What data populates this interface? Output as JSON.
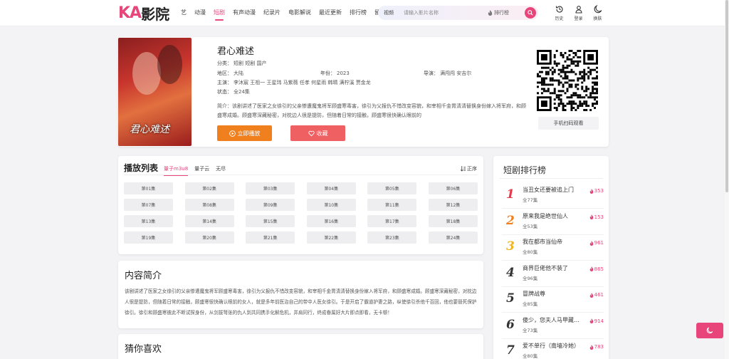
{
  "logo": {
    "ka": "KA",
    "name": "影院"
  },
  "nav": [
    "艺",
    "动漫",
    "短剧",
    "有声动漫",
    "纪录片",
    "电影解说",
    "最近更新",
    "排行榜",
    "留"
  ],
  "nav_active": 2,
  "search": {
    "category": "视频",
    "placeholder": "请输入影片名称",
    "rank_label": "排行榜"
  },
  "header_icons": [
    {
      "label": "历史",
      "icon": "history-icon"
    },
    {
      "label": "登录",
      "icon": "user-icon"
    },
    {
      "label": "换肤",
      "icon": "moon-icon"
    }
  ],
  "detail": {
    "poster_text": "君心难述",
    "title": "君心难述",
    "category_label": "分类：",
    "category": "短剧  短剧  国产",
    "region_label": "地区：",
    "region": "大陆",
    "year_label": "年份：",
    "year": "2023",
    "director_label": "导演：",
    "director": "满闯闯  安吉尔",
    "cast_label": "主演：",
    "cast": "李沐宸  王祖一  王星玮  马紫薇  任孝  何星雨  韩晴  满柠溪  贾金龙",
    "status_label": "状态：",
    "status": "全24集",
    "desc": "简介：该剧讲述了医家之女徐引的父亲惨遭魔鬼将军顾盛寒毒害，徐引为父报仇不惜改变容貌，和宰相千金胃清清替换身份嫁入将军府，和顾盛寒成婚。顾盛寒深藏秘密，对枕边人很是提防，但随着日常的接触，顾盛寒很快确认眼前的",
    "play_label": "立即播放",
    "fav_label": "收藏",
    "qr_label": "手机扫码观看"
  },
  "playlist": {
    "title": "播放列表",
    "tabs": [
      "量子m3u8",
      "量子云",
      "无尽"
    ],
    "active_tab": 0,
    "sort_label": "正序",
    "episodes": [
      "第01集",
      "第02集",
      "第03集",
      "第04集",
      "第05集",
      "第06集",
      "第07集",
      "第08集",
      "第09集",
      "第10集",
      "第11集",
      "第12集",
      "第13集",
      "第14集",
      "第15集",
      "第16集",
      "第17集",
      "第18集",
      "第19集",
      "第20集",
      "第21集",
      "第22集",
      "第23集",
      "第24集"
    ]
  },
  "intro": {
    "title": "内容简介",
    "text": "该剧讲述了医家之女徐引的父亲惨遭魔鬼将军顾盛寒毒害，徐引为父报仇不惜改变容貌，和宰相千金胃清清替换身份嫁入将军府，和顾盛寒成婚。顾盛寒深藏秘密，对枕边人很是提防，但随着日常的接触，顾盛寒很快确认眼前的女人，就是多年前医治自己的带中人医女徐引。于是开启了霸道护妻之路，纵使徐引杀他千百回，他也要替死保护徐引。徐引和顾盛寒彼此不断试探身份，从剑拔弩张的仇人到共同携手化解危机，并肩同行，终成眷属好大片即点即看，无卡顿！"
  },
  "guess": {
    "title": "猜你喜欢"
  },
  "ranking": {
    "title": "短剧排行榜",
    "items": [
      {
        "rank": "1",
        "name": "当丑女还要被追上门",
        "episodes": "全77集",
        "hot": "353",
        "color": "#e8394a"
      },
      {
        "rank": "2",
        "name": "原来我是绝世仙人",
        "episodes": "全53集",
        "hot": "153",
        "color": "#f0801e"
      },
      {
        "rank": "3",
        "name": "我在都市当仙帝",
        "episodes": "全80集",
        "hot": "961",
        "color": "#f2b521"
      },
      {
        "rank": "4",
        "name": "商界巨佬他不装了",
        "episodes": "全96集",
        "hot": "865",
        "color": "#333333"
      },
      {
        "rank": "5",
        "name": "冒牌战尊",
        "episodes": "全85集",
        "hot": "461",
        "color": "#333333"
      },
      {
        "rank": "6",
        "name": "傻少，您夫人马甲藏不住了",
        "episodes": "全73集",
        "hot": "914",
        "color": "#333333"
      },
      {
        "rank": "7",
        "name": "爱不单行（南墙冷她）",
        "episodes": "全80集",
        "hot": "783",
        "color": "#333333"
      }
    ]
  }
}
